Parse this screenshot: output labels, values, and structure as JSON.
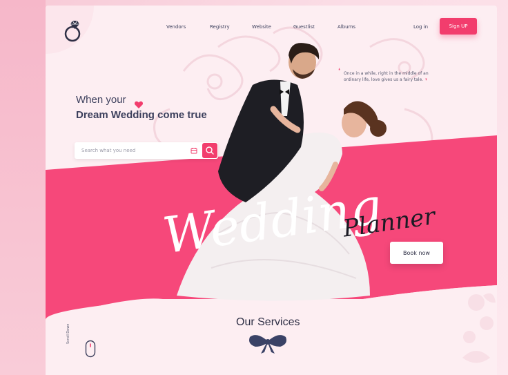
{
  "nav": {
    "items": [
      {
        "label": "Vendors"
      },
      {
        "label": "Registry"
      },
      {
        "label": "Website"
      },
      {
        "label": "Guestlist"
      },
      {
        "label": "Albums"
      }
    ],
    "login_label": "Log in",
    "signup_label": "Sign UP"
  },
  "hero": {
    "line1": "When your",
    "line2": "Dream Wedding come true",
    "search_placeholder": "Search what you need",
    "quote": "Once in a while, right in the middle of an ordinary life, love gives us a fairy tale.",
    "script_word1": "Wedding",
    "script_word2": "Planner",
    "book_label": "Book now"
  },
  "services": {
    "title": "Our Services"
  },
  "scroll": {
    "label": "Scroll Down"
  },
  "colors": {
    "accent": "#f23d6d",
    "band": "#f6487a",
    "text_dark": "#3c3f5c",
    "page_bg": "#fdeef2"
  },
  "icons": [
    "diamond-ring-icon",
    "heart-icon",
    "calendar-icon",
    "search-icon",
    "bow-icon",
    "mouse-icon",
    "flower-icon"
  ]
}
